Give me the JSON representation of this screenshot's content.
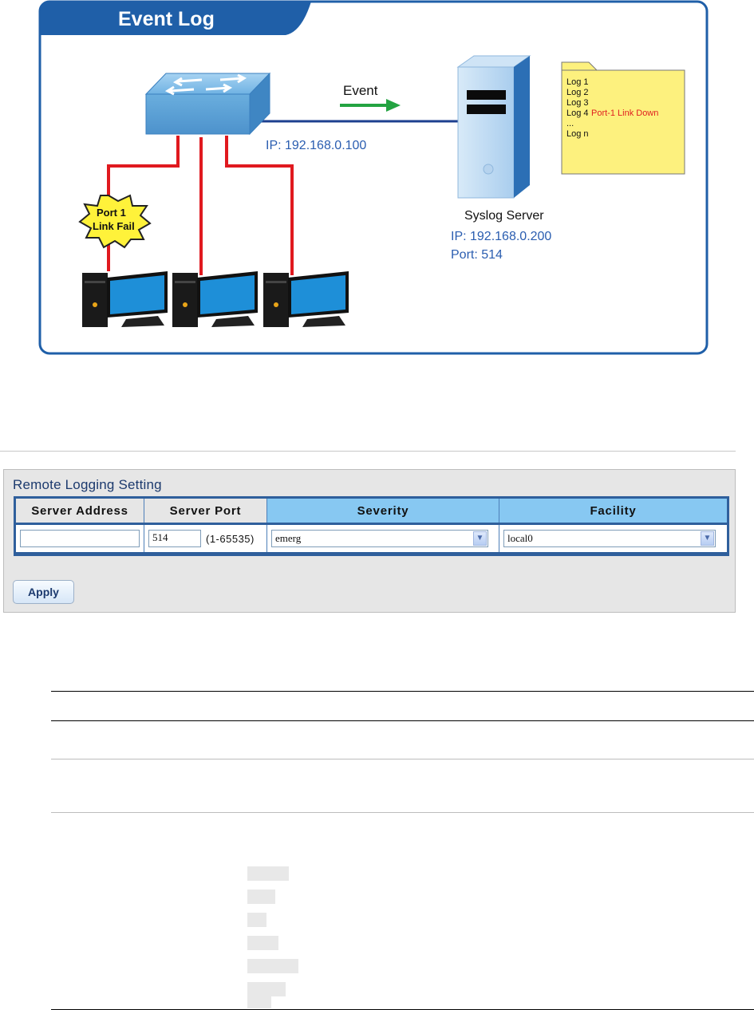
{
  "figure": {
    "title": "Event Log",
    "event_label": "Event",
    "switch_ip": "IP: 192.168.0.100",
    "port_fail": [
      "Port 1",
      "Link Fail"
    ],
    "syslog_server": "Syslog Server",
    "server_ip": "IP: 192.168.0.200",
    "server_port": "Port: 514",
    "log_lines": [
      {
        "text": "Log 1",
        "alert": ""
      },
      {
        "text": "Log 2",
        "alert": ""
      },
      {
        "text": "Log 3",
        "alert": ""
      },
      {
        "text": "Log 4",
        "alert": "Port-1 Link Down"
      },
      {
        "text": "...",
        "alert": ""
      },
      {
        "text": "Log n",
        "alert": ""
      }
    ],
    "colors": {
      "frame": "#1f5fa8",
      "link": "#e0191f",
      "server_text": "#2a5db0",
      "note": "#fdf17e",
      "alert": "#e02020"
    }
  },
  "remote_logging": {
    "title": "Remote Logging Setting",
    "headers": {
      "address": "Server Address",
      "port": "Server Port",
      "severity": "Severity",
      "facility": "Facility"
    },
    "address_value": "",
    "port_value": "514",
    "port_range": "(1-65535)",
    "severity_value": "emerg",
    "facility_value": "local0",
    "apply_label": "Apply"
  },
  "severity_highlights": 7
}
